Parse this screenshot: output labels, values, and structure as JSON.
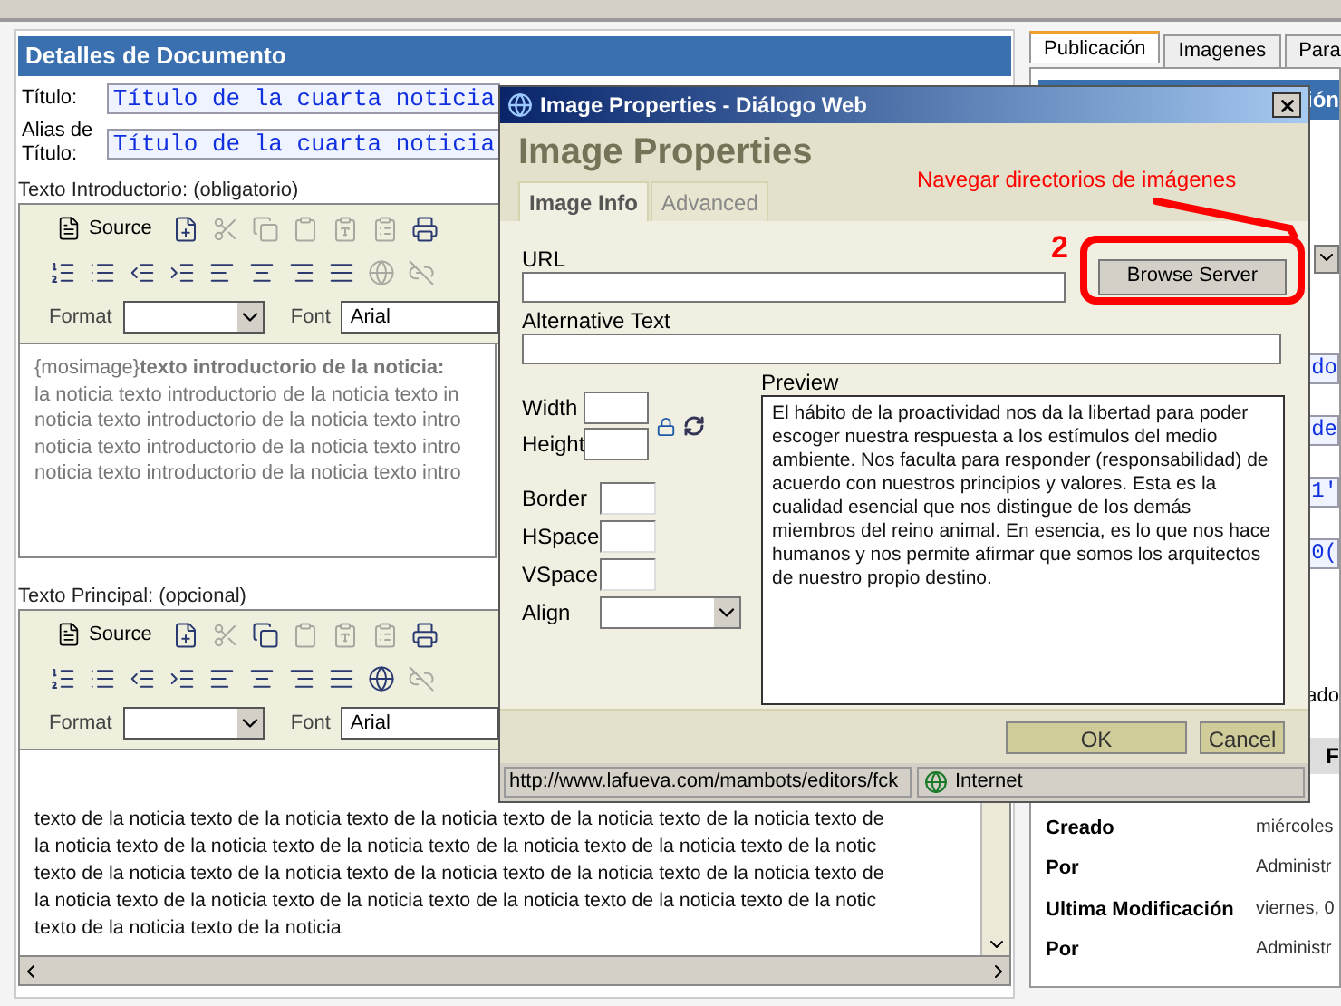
{
  "document_panel": {
    "title": "Detalles de Documento",
    "fields": [
      {
        "label": "Título:",
        "value": "Título de la cuarta noticia"
      },
      {
        "label": "Alias de Título:",
        "value": "Título de la cuarta noticia"
      }
    ],
    "editors": [
      {
        "label": "Texto Introductorio: (obligatorio)",
        "source": "Source",
        "format_label": "Format",
        "font_label": "Font",
        "font_value": "Arial",
        "scrollbars": false,
        "muted": true,
        "lines": [
          "{mosimage}**texto introductorio de la noticia:**",
          "la noticia texto introductorio de la noticia texto in",
          "noticia texto introductorio de la noticia texto intro",
          "noticia texto introductorio de la noticia texto intro",
          "noticia texto introductorio de la noticia texto intro"
        ]
      },
      {
        "label": "Texto Principal: (opcional)",
        "source": "Source",
        "format_label": "Format",
        "font_label": "Font",
        "font_value": "Arial",
        "scrollbars": true,
        "muted": false,
        "lines": [
          "texto de la noticia texto de la noticia texto de la noticia texto de la noticia texto de la noticia texto de",
          "la noticia texto de la noticia texto de la noticia texto de la noticia texto de la noticia texto de la notic",
          "texto de la noticia texto de la noticia texto de la noticia texto de la noticia texto de la noticia texto de",
          "la noticia texto de la noticia texto de la noticia texto de la noticia texto de la noticia texto de la notic",
          "texto de la noticia texto de la noticia"
        ]
      }
    ]
  },
  "right_panel": {
    "tabs": [
      {
        "label": "Publicación",
        "selected": true
      },
      {
        "label": "Imagenes",
        "selected": false
      },
      {
        "label": "Para",
        "selected": false
      }
    ],
    "header_fragment": "ión",
    "field_fragments": [
      "do",
      "de",
      "1'",
      "0("
    ],
    "label_fragment": "ado",
    "table_header_fragment": "F",
    "info_rows": [
      {
        "label": "Creado",
        "value": "miércoles"
      },
      {
        "label": "Por",
        "value": "Administr"
      },
      {
        "label": "Ultima Modificación",
        "value": "viernes, 0"
      },
      {
        "label": "Por",
        "value": "Administr"
      }
    ]
  },
  "dialog": {
    "title": "Image Properties - Diálogo Web",
    "heading": "Image Properties",
    "tabs": [
      {
        "label": "Image Info",
        "selected": true
      },
      {
        "label": "Advanced",
        "selected": false
      }
    ],
    "annotation": {
      "text": "Navegar directorios de imágenes",
      "step": "2"
    },
    "url_label": "URL",
    "browse_button": "Browse Server",
    "alt_label": "Alternative Text",
    "dimension_fields": [
      "Width",
      "Height"
    ],
    "spacing_fields": [
      "Border",
      "HSpace",
      "VSpace"
    ],
    "align_label": "Align",
    "preview_label": "Preview",
    "preview_text": "El hábito de la proactividad nos da la libertad para poder escoger nuestra respuesta a los estímulos del medio ambiente. Nos faculta para responder (responsabilidad) de acuerdo con nuestros principios y valores. Esta es la cualidad esencial que nos distingue de los demás miembros del reino animal. En esencia, es lo que nos hace humanos y nos permite afirmar que somos los arquitectos de nuestro propio destino.",
    "buttons": [
      "OK",
      "Cancel"
    ],
    "status_url": "http://www.lafueva.com/mambots/editors/fck",
    "zone": "Internet"
  }
}
